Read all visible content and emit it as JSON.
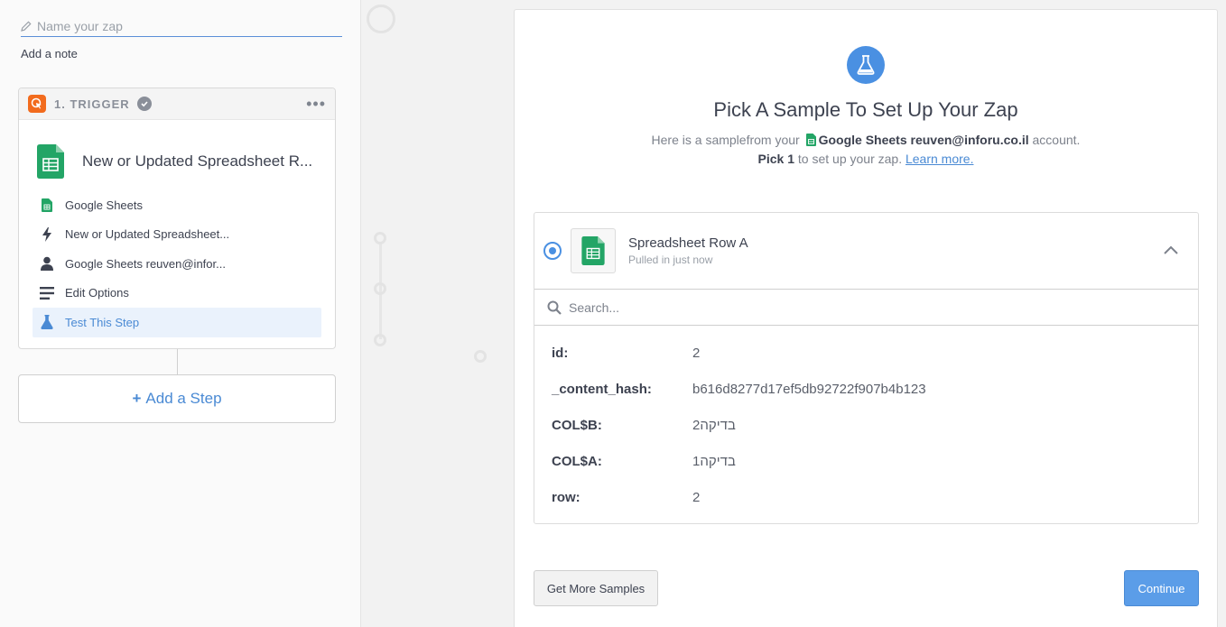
{
  "editor": {
    "zap_name_placeholder": "Name your zap",
    "add_note": "Add a note"
  },
  "trigger": {
    "label": "1. TRIGGER",
    "title": "New or Updated Spreadsheet R...",
    "steps": [
      {
        "label": "Google Sheets",
        "icon": "google-sheets-icon"
      },
      {
        "label": "New or Updated Spreadsheet...",
        "icon": "lightning-icon"
      },
      {
        "label": "Google Sheets reuven@infor...",
        "icon": "user-icon"
      },
      {
        "label": "Edit Options",
        "icon": "list-icon"
      },
      {
        "label": "Test This Step",
        "icon": "flask-icon",
        "active": true
      }
    ]
  },
  "add_step": {
    "plus": "+",
    "label": "Add a Step"
  },
  "panel": {
    "title": "Pick A Sample To Set Up Your Zap",
    "sub_prefix": "Here is a samplefrom your",
    "account": "Google Sheets reuven@inforu.co.il",
    "sub_suffix": "account.",
    "pick_bold": "Pick 1",
    "pick_rest": "to set up your zap.",
    "learn_more": "Learn more."
  },
  "sample": {
    "name": "Spreadsheet Row A",
    "time": "Pulled in just now",
    "search_placeholder": "Search...",
    "fields": [
      {
        "key": "id:",
        "value": "2"
      },
      {
        "key": "_content_hash:",
        "value": "b616d8277d17ef5db92722f907b4b123"
      },
      {
        "key": "COL$B:",
        "value": "בדיקה2"
      },
      {
        "key": "COL$A:",
        "value": "בדיקה1"
      },
      {
        "key": "row:",
        "value": "2"
      }
    ]
  },
  "buttons": {
    "get_more": "Get More Samples",
    "continue": "Continue"
  },
  "colors": {
    "accent": "#4a90e2",
    "sheets_green": "#23a566",
    "trigger_orange": "#f26b1d"
  }
}
